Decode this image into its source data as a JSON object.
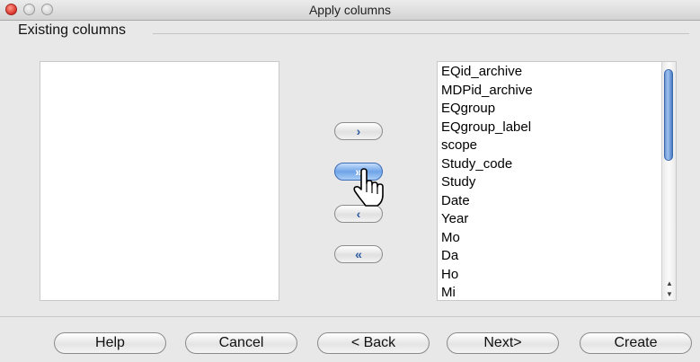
{
  "window": {
    "title": "Apply columns"
  },
  "group": {
    "label": "Existing columns"
  },
  "left_list": {
    "items": []
  },
  "right_list": {
    "items": [
      "EQid_archive",
      "MDPid_archive",
      "EQgroup",
      "EQgroup_label",
      "scope",
      "Study_code",
      "Study",
      "Date",
      "Year",
      "Mo",
      "Da",
      "Ho",
      "Mi"
    ]
  },
  "move_buttons": {
    "add_one": "›",
    "add_all": "»",
    "remove_one": "‹",
    "remove_all": "«"
  },
  "footer": {
    "help": "Help",
    "cancel": "Cancel",
    "back": "< Back",
    "next": "Next>",
    "create": "Create"
  }
}
